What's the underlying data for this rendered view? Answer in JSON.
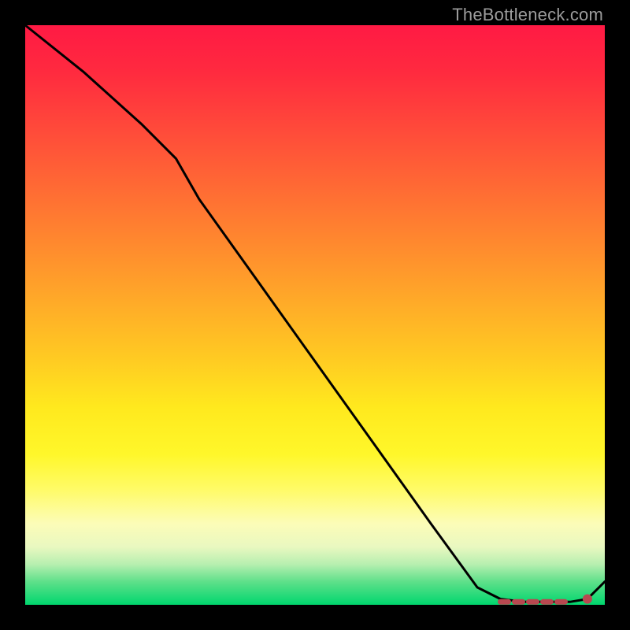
{
  "watermark": "TheBottleneck.com",
  "chart_data": {
    "type": "line",
    "title": "",
    "xlabel": "",
    "ylabel": "",
    "xlim": [
      0,
      100
    ],
    "ylim": [
      0,
      100
    ],
    "series": [
      {
        "name": "curve",
        "x": [
          0,
          10,
          20,
          26,
          30,
          40,
          50,
          60,
          70,
          78,
          82,
          86,
          90,
          94,
          97,
          100
        ],
        "values": [
          100,
          92,
          83,
          77,
          70,
          56,
          42,
          28,
          14,
          3,
          1,
          0.5,
          0.5,
          0.5,
          1,
          4
        ]
      }
    ],
    "flat_segment": {
      "x_start": 82,
      "x_end": 94,
      "y": 0.5,
      "note": "dashed near-zero plateau"
    },
    "end_marker": {
      "x": 97,
      "y": 1
    }
  },
  "colors": {
    "curve": "#000000",
    "dash": "#b84850",
    "marker": "#b84850"
  }
}
